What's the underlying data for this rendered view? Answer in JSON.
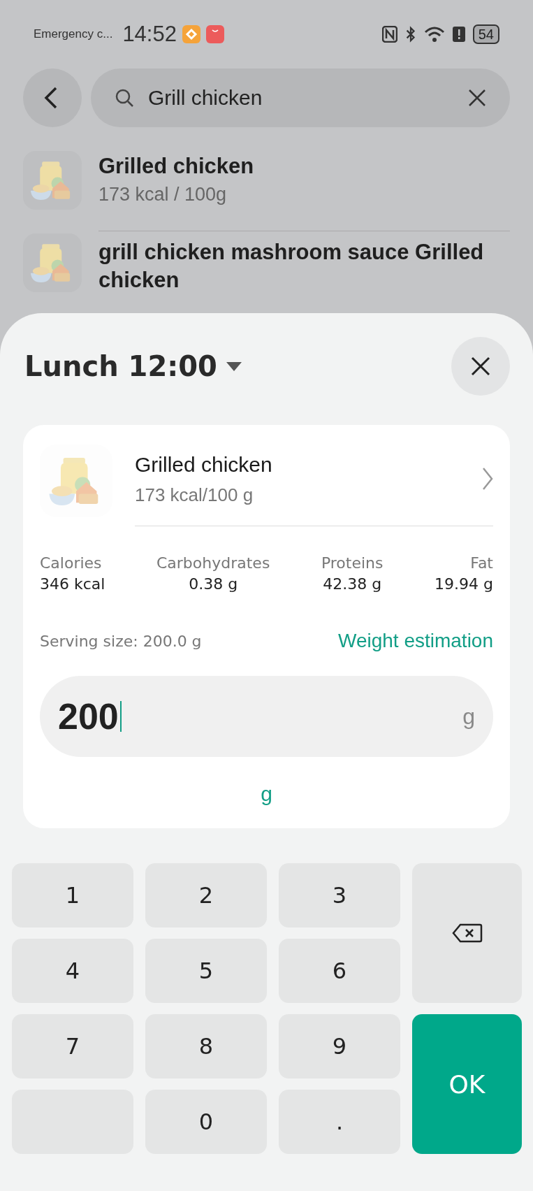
{
  "status_bar": {
    "carrier": "Emergency c...",
    "time": "14:52",
    "battery": "54"
  },
  "search": {
    "value": "Grill chicken"
  },
  "results": [
    {
      "name": "Grilled chicken",
      "calories": "173 kcal / 100g"
    },
    {
      "name": "grill chicken mashroom sauce Grilled chicken"
    }
  ],
  "sheet": {
    "meal": "Lunch 12:00",
    "food": {
      "name": "Grilled chicken",
      "calories": "173 kcal/100 g"
    },
    "nutrients": [
      {
        "label": "Calories",
        "value": "346 kcal"
      },
      {
        "label": "Carbohydrates",
        "value": "0.38 g"
      },
      {
        "label": "Proteins",
        "value": "42.38 g"
      },
      {
        "label": "Fat",
        "value": "19.94 g"
      }
    ],
    "serving": "Serving size: 200.0 g",
    "estimate_link": "Weight estimation",
    "amount": {
      "value": "200",
      "unit": "g"
    },
    "unit_option": "g"
  },
  "keypad": [
    {
      "kind": "digit",
      "label": "1"
    },
    {
      "kind": "digit",
      "label": "2"
    },
    {
      "kind": "digit",
      "label": "3"
    },
    {
      "kind": "backspace"
    },
    {
      "kind": "digit",
      "label": "4"
    },
    {
      "kind": "digit",
      "label": "5"
    },
    {
      "kind": "digit",
      "label": "6"
    },
    {
      "kind": "digit",
      "label": "7"
    },
    {
      "kind": "digit",
      "label": "8"
    },
    {
      "kind": "digit",
      "label": "9"
    },
    {
      "kind": "ok",
      "label": "OK"
    },
    {
      "kind": "blank"
    },
    {
      "kind": "digit",
      "label": "0"
    },
    {
      "kind": "digit",
      "label": "."
    }
  ]
}
